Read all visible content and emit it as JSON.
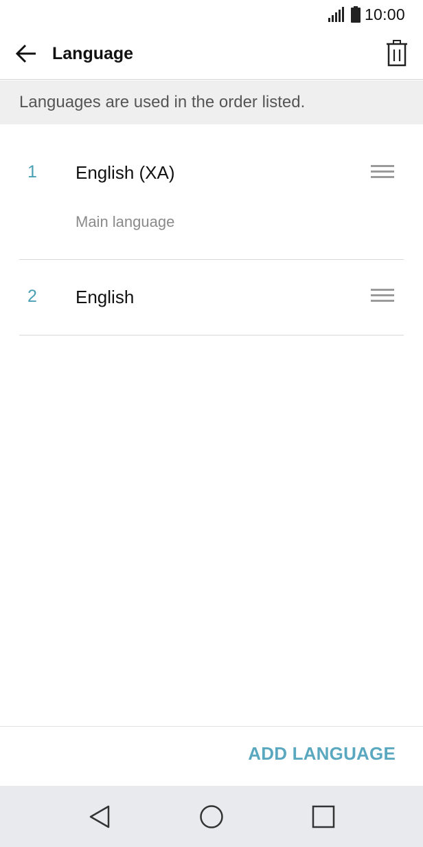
{
  "status_bar": {
    "time": "10:00",
    "icons": [
      "signal-icon",
      "battery-icon"
    ]
  },
  "app_bar": {
    "title": "Language",
    "back_icon": "arrow-left-icon",
    "delete_icon": "trash-icon"
  },
  "info": {
    "text": "Languages are used in the order listed."
  },
  "languages": [
    {
      "number": "1",
      "name": "English (XA)",
      "subtitle": "Main language"
    },
    {
      "number": "2",
      "name": "English"
    }
  ],
  "actions": {
    "add_language": "ADD LANGUAGE"
  },
  "nav": {
    "back_icon": "triangle-back-icon",
    "home_icon": "circle-home-icon",
    "recent_icon": "square-recents-icon"
  },
  "colors": {
    "accent": "#4a9fb5",
    "action": "#5aa8bf",
    "banner": "#efefef",
    "nav_bar": "#e8eaee"
  }
}
